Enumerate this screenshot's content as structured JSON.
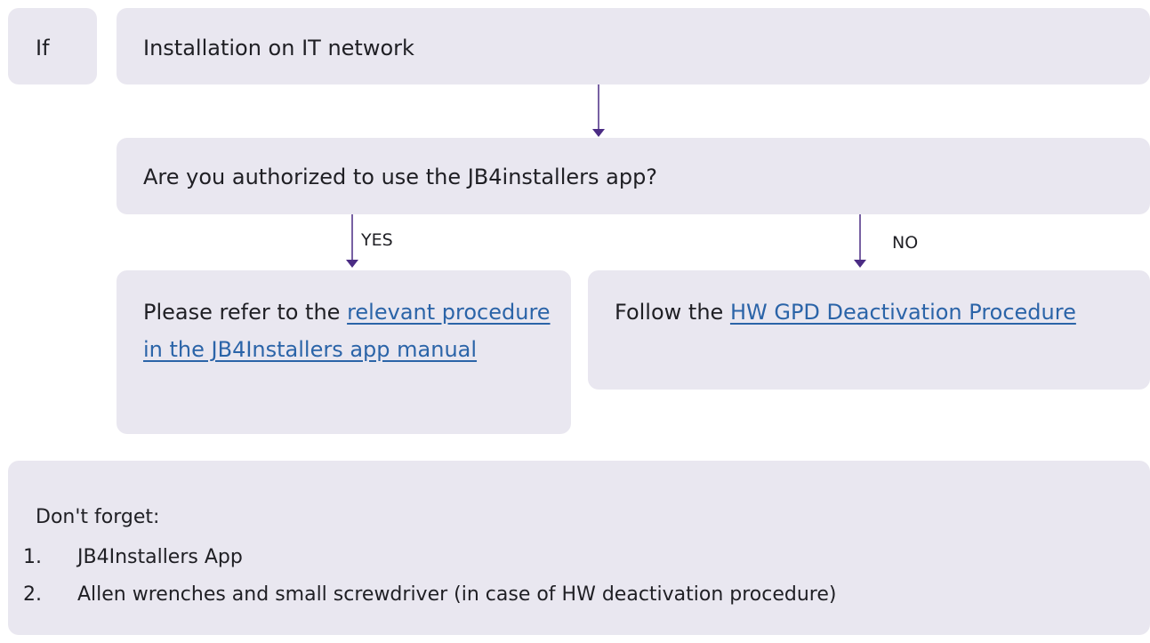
{
  "if_box": {
    "label": "If"
  },
  "condition": {
    "text": "Installation on IT network"
  },
  "question": {
    "text": "Are you authorized to use the JB4installers app?"
  },
  "branches": {
    "yes": {
      "label": "YES",
      "prefix": "Please refer to the ",
      "link_text": "relevant procedure in the JB4Installers app manual"
    },
    "no": {
      "label": "NO",
      "prefix": "Follow the ",
      "link_text": "HW GPD Deactivation Procedure"
    }
  },
  "reminder": {
    "title": "Don't forget:",
    "items": [
      {
        "number": "1.",
        "text": "JB4Installers App"
      },
      {
        "number": "2.",
        "text": "Allen wrenches and small screwdriver (in case of HW deactivation procedure)"
      }
    ]
  },
  "colors": {
    "box_background": "#e9e7f0",
    "arrow": "#4b2c84",
    "link": "#2b64a8"
  }
}
